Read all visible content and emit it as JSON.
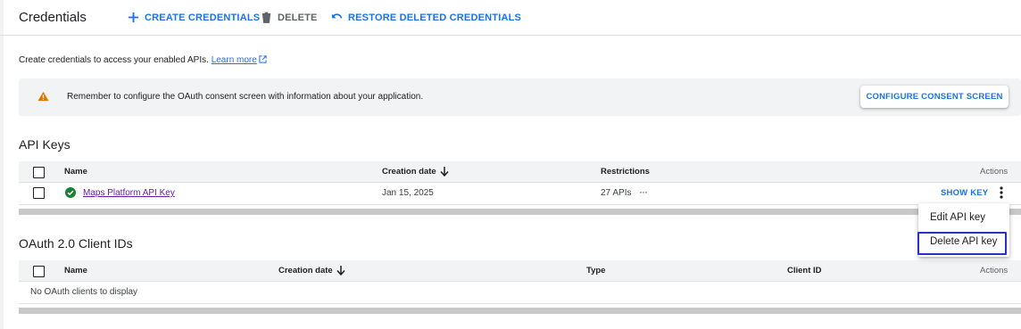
{
  "header": {
    "title": "Credentials",
    "create_label": "CREATE CREDENTIALS",
    "delete_label": "DELETE",
    "restore_label": "RESTORE DELETED CREDENTIALS"
  },
  "intro": {
    "text": "Create credentials to access your enabled APIs.",
    "learn_more": "Learn more"
  },
  "banner": {
    "text": "Remember to configure the OAuth consent screen with information about your application.",
    "button": "CONFIGURE CONSENT SCREEN"
  },
  "api_keys": {
    "title": "API Keys",
    "columns": {
      "name": "Name",
      "creation_date": "Creation date",
      "restrictions": "Restrictions",
      "actions": "Actions"
    },
    "rows": [
      {
        "name": "Maps Platform API Key",
        "creation_date": "Jan 15, 2025",
        "restrictions": "27 APIs",
        "more": "···",
        "show_key": "SHOW KEY"
      }
    ]
  },
  "context_menu": {
    "items": [
      "Edit API key",
      "Delete API key"
    ]
  },
  "oauth": {
    "title": "OAuth 2.0 Client IDs",
    "columns": {
      "name": "Name",
      "creation_date": "Creation date",
      "type": "Type",
      "client_id": "Client ID",
      "actions": "Actions"
    },
    "empty": "No OAuth clients to display"
  },
  "colors": {
    "accent": "#1a73e8",
    "warning": "#e37400",
    "success": "#188038",
    "link_visited": "#681da8",
    "highlight": "#2a2fcf"
  }
}
